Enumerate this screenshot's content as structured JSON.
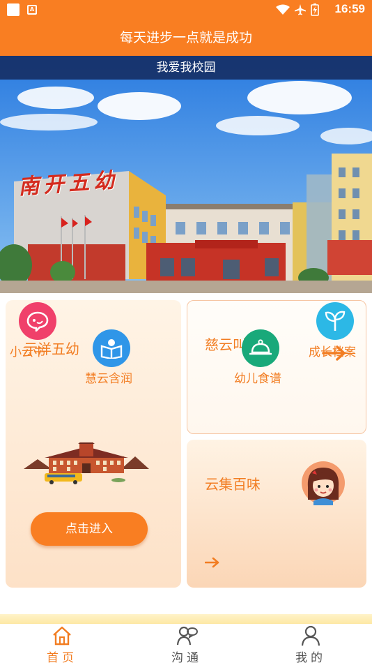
{
  "status_bar": {
    "time": "16:59",
    "notif_badge": "A"
  },
  "header": {
    "title": "每天进步一点就是成功"
  },
  "banner": {
    "caption": "我爱我校园",
    "sign_text": "南开五幼"
  },
  "cards": {
    "left": {
      "title": "示洋五幼",
      "button": "点击进入"
    },
    "right_top": {
      "title": "慈云叫"
    },
    "right_bottom": {
      "title": "云集百味"
    }
  },
  "menu": [
    {
      "label": "小云书",
      "icon": "chat-bubble-icon",
      "color": "#f0406a"
    },
    {
      "label": "慧云含润",
      "icon": "book-reading-icon",
      "color": "#2f96e8"
    },
    {
      "label": "幼儿食谱",
      "icon": "food-cloche-icon",
      "color": "#19a97a"
    },
    {
      "label": "成长档案",
      "icon": "sprout-icon",
      "color": "#2cb8e6"
    }
  ],
  "tabs": [
    {
      "label": "首页",
      "icon": "home-icon",
      "active": true
    },
    {
      "label": "沟通",
      "icon": "people-chat-icon",
      "active": false
    },
    {
      "label": "我的",
      "icon": "person-icon",
      "active": false
    }
  ],
  "colors": {
    "accent": "#f97e22",
    "active_tab": "#f27d22",
    "inactive_tab": "#555555"
  }
}
